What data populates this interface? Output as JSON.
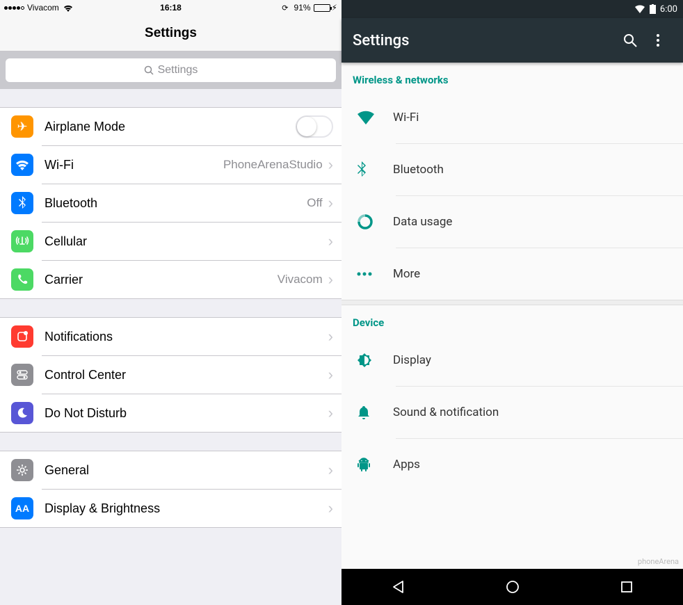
{
  "ios": {
    "statusbar": {
      "carrier": "Vivacom",
      "time": "16:18",
      "battery_pct": "91%"
    },
    "navbar_title": "Settings",
    "search_placeholder": "Settings",
    "groups": [
      [
        {
          "key": "airplane",
          "label": "Airplane Mode",
          "value": "",
          "toggle": true
        },
        {
          "key": "wifi",
          "label": "Wi-Fi",
          "value": "PhoneArenaStudio"
        },
        {
          "key": "bluetooth",
          "label": "Bluetooth",
          "value": "Off"
        },
        {
          "key": "cellular",
          "label": "Cellular",
          "value": ""
        },
        {
          "key": "carrier",
          "label": "Carrier",
          "value": "Vivacom"
        }
      ],
      [
        {
          "key": "notifications",
          "label": "Notifications",
          "value": ""
        },
        {
          "key": "control",
          "label": "Control Center",
          "value": ""
        },
        {
          "key": "dnd",
          "label": "Do Not Disturb",
          "value": ""
        }
      ],
      [
        {
          "key": "general",
          "label": "General",
          "value": ""
        },
        {
          "key": "display",
          "label": "Display & Brightness",
          "value": ""
        }
      ]
    ]
  },
  "android": {
    "statusbar": {
      "time": "6:00"
    },
    "appbar_title": "Settings",
    "sections": [
      {
        "header": "Wireless & networks",
        "items": [
          {
            "key": "wifi",
            "label": "Wi-Fi"
          },
          {
            "key": "bluetooth",
            "label": "Bluetooth"
          },
          {
            "key": "data",
            "label": "Data usage"
          },
          {
            "key": "more",
            "label": "More"
          }
        ]
      },
      {
        "header": "Device",
        "items": [
          {
            "key": "display",
            "label": "Display"
          },
          {
            "key": "sound",
            "label": "Sound & notification"
          },
          {
            "key": "apps",
            "label": "Apps"
          }
        ]
      }
    ],
    "watermark": "phoneArena"
  }
}
